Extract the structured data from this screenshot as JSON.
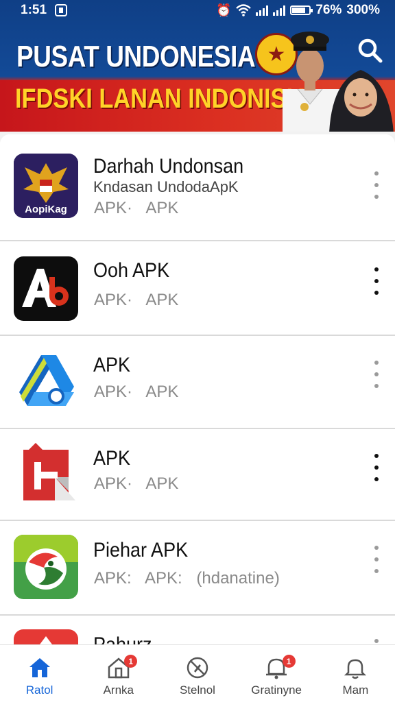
{
  "status_bar": {
    "time": "1:51",
    "battery_pct": "76%",
    "extra": "300%"
  },
  "header": {
    "title": "PUSAT UNDONESIA",
    "subtitle": "IFDSKI LANAN INDONISIA"
  },
  "apps": [
    {
      "title": "Darhah Undonsan",
      "subtitle": "Kndasan UndodaApK",
      "meta": "APK· APK",
      "icon": "garuda-icon",
      "icon_text": "AopiKag"
    },
    {
      "title": "Ooh APK",
      "subtitle": "",
      "meta": "APK· APK",
      "icon": "a-logo-icon"
    },
    {
      "title": "APK",
      "subtitle": "",
      "meta": "APK· APK",
      "icon": "drive-like-icon"
    },
    {
      "title": "APK",
      "subtitle": "",
      "meta": "APK· APK",
      "icon": "red-paper-icon"
    },
    {
      "title": "Piehar APK",
      "subtitle": "",
      "meta": "APK: APK: (hdanatine)",
      "icon": "green-bird-icon"
    },
    {
      "title": "Pahurz",
      "subtitle": "",
      "meta": "",
      "icon": "red-app-icon"
    }
  ],
  "nav": [
    {
      "label": "Ratol",
      "icon": "home-icon",
      "badge": ""
    },
    {
      "label": "Arnka",
      "icon": "house-icon",
      "badge": "1"
    },
    {
      "label": "Stelnol",
      "icon": "compass-icon",
      "badge": ""
    },
    {
      "label": "Gratinyne",
      "icon": "bell-icon",
      "badge": "1"
    },
    {
      "label": "Mam",
      "icon": "bell-outline-icon",
      "badge": ""
    }
  ],
  "colors": {
    "accent": "#1565d8",
    "header_blue": "#0f3f86",
    "header_red": "#d9321f",
    "title_yellow": "#ffd328"
  }
}
